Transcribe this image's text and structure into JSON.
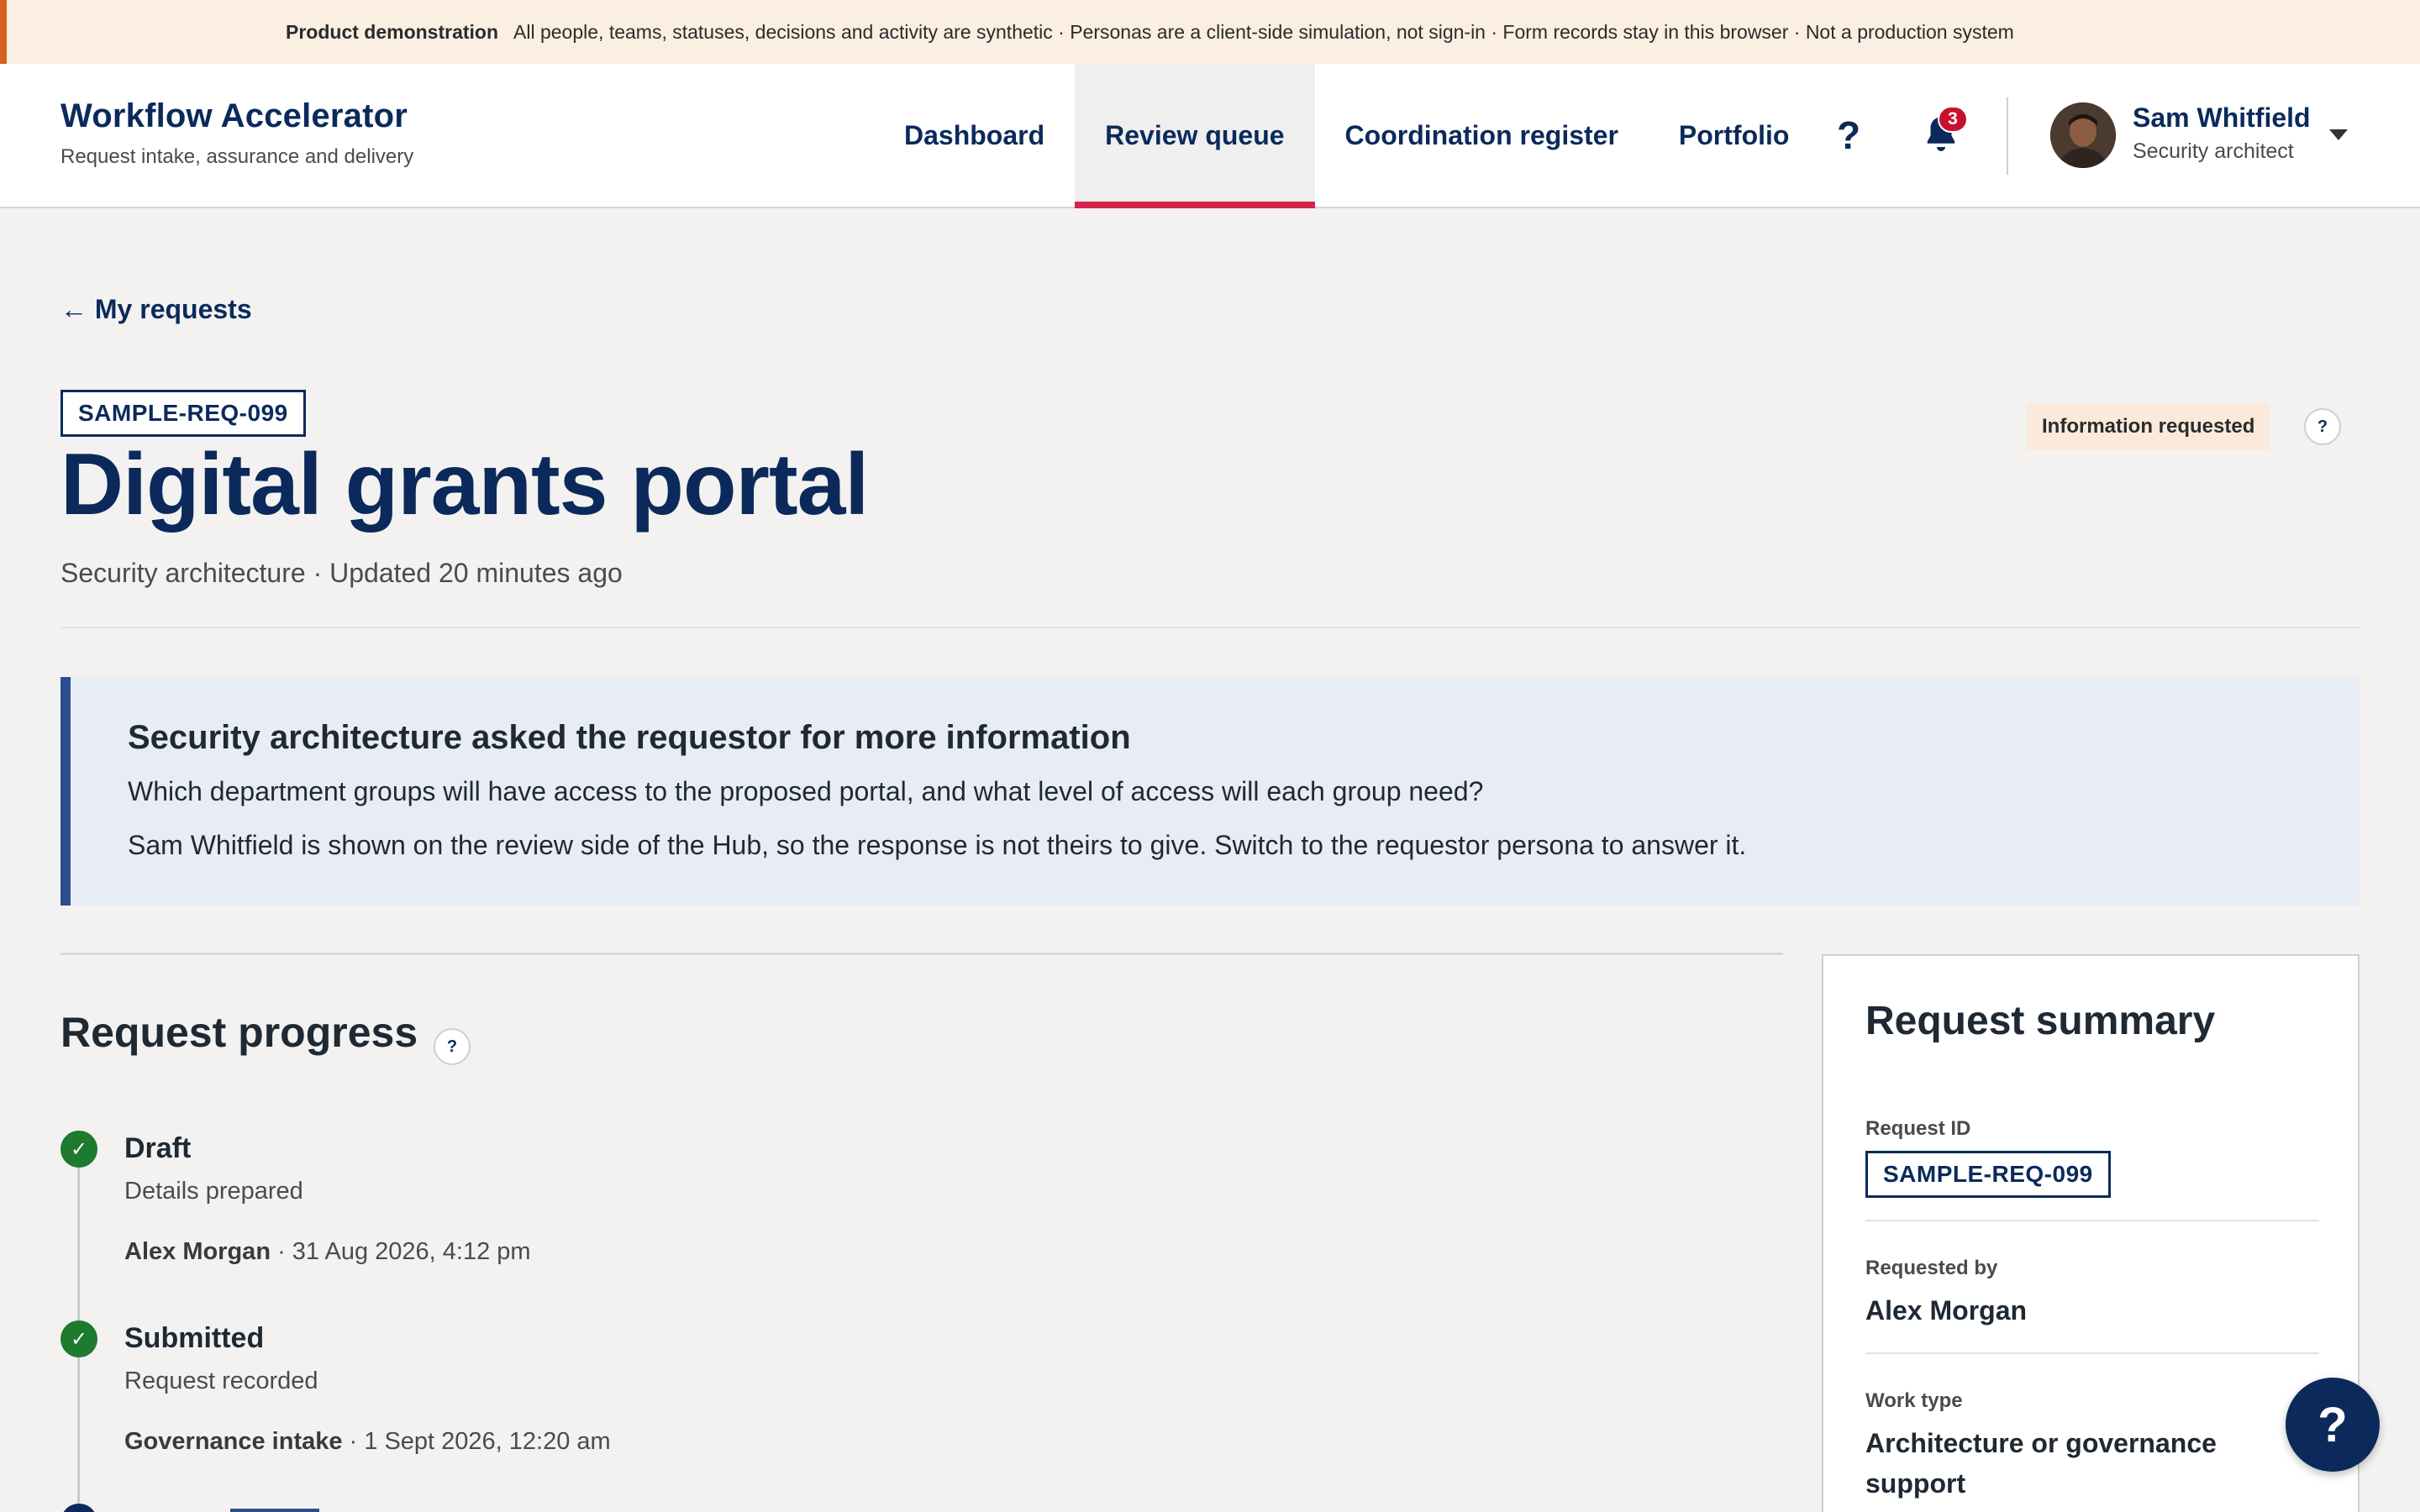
{
  "demo_banner": {
    "tag": "Product demonstration",
    "text": "All people, teams, statuses, decisions and activity are synthetic · Personas are a client-side simulation, not sign-in · Form records stay in this browser · Not a production system"
  },
  "header": {
    "brand_title": "Workflow Accelerator",
    "brand_subtitle": "Request intake, assurance and delivery",
    "nav": [
      {
        "label": "Dashboard",
        "active": false
      },
      {
        "label": "Review queue",
        "active": true
      },
      {
        "label": "Coordination register",
        "active": false
      },
      {
        "label": "Portfolio",
        "active": false
      }
    ],
    "help_icon": "question-icon",
    "bell_icon": "bell-icon",
    "notification_count": "3",
    "user": {
      "name": "Sam Whitfield",
      "role": "Security architect"
    }
  },
  "page": {
    "back_link": "← My requests",
    "request_id": "SAMPLE-REQ-099",
    "title": "Digital grants portal",
    "meta": "Security architecture · Updated 20 minutes ago",
    "status": "Information requested"
  },
  "callout": {
    "title": "Security architecture asked the requestor for more information",
    "question": "Which department groups will have access to the proposed portal, and what level of access will each group need?",
    "note": "Sam Whitfield is shown on the review side of the Hub, so the response is not theirs to give. Switch to the requestor persona to answer it."
  },
  "progress": {
    "title": "Request progress",
    "steps": [
      {
        "title": "Draft",
        "desc": "Details prepared",
        "actor": "Alex Morgan",
        "time": " · 31 Aug 2026, 4:12 pm"
      },
      {
        "title": "Submitted",
        "desc": "Request recorded",
        "actor": "Governance intake",
        "time": " · 1 Sept 2026, 12:20 am"
      }
    ]
  },
  "summary": {
    "title": "Request summary",
    "request_id_label": "Request ID",
    "request_id": "SAMPLE-REQ-099",
    "requested_by_label": "Requested by",
    "requested_by": "Alex Morgan",
    "work_type_label": "Work type",
    "work_type": "Architecture or governance support"
  },
  "colors": {
    "brand_navy": "#0b2a5b",
    "accent_red": "#d4264a",
    "success_green": "#1d7a2f",
    "banner_orange": "#d4621f"
  }
}
